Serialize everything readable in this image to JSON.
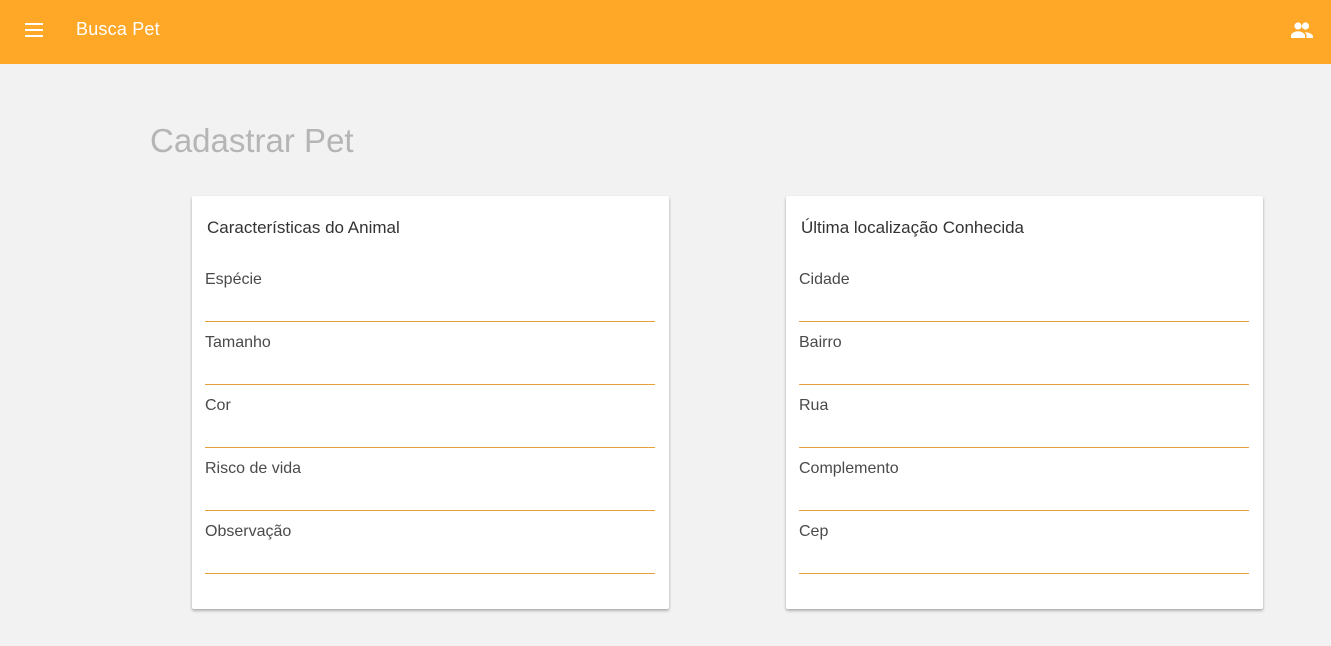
{
  "header": {
    "app_title": "Busca Pet",
    "menu_icon": "menu-icon",
    "account_icon": "people-icon",
    "bar_color": "#ffa726"
  },
  "page": {
    "title": "Cadastrar Pet"
  },
  "animal_card": {
    "title": "Características do Animal",
    "fields": [
      {
        "label": "Espécie"
      },
      {
        "label": "Tamanho"
      },
      {
        "label": "Cor"
      },
      {
        "label": "Risco de vida"
      },
      {
        "label": "Observação"
      }
    ]
  },
  "location_card": {
    "title": "Última localização Conhecida",
    "fields": [
      {
        "label": "Cidade"
      },
      {
        "label": "Bairro"
      },
      {
        "label": "Rua"
      },
      {
        "label": "Complemento"
      },
      {
        "label": "Cep"
      }
    ]
  }
}
